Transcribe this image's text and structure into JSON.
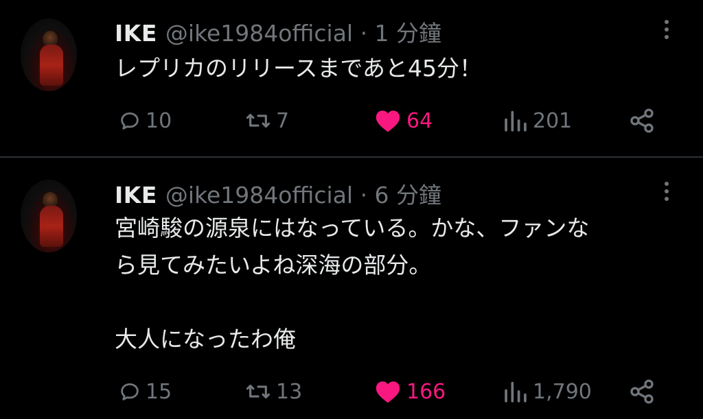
{
  "tweets": [
    {
      "name": "IKE",
      "meta": "@ike1984official · 1 分鐘",
      "text": "レプリカのリリースまであと45分！",
      "replies": "10",
      "retweets": "7",
      "likes": "64",
      "views": "201",
      "liked": true
    },
    {
      "name": "IKE",
      "meta": "@ike1984official · 6 分鐘",
      "text_lines": [
        "宮崎駿の源泉にはなっている。かな、ファンな",
        "ら見てみたいよね深海の部分。",
        "",
        "大人になったわ俺"
      ],
      "replies": "15",
      "retweets": "13",
      "likes": "166",
      "views": "1,790",
      "liked": true
    }
  ],
  "icons": {
    "reply": "reply-icon",
    "retweet": "retweet-icon",
    "like": "heart-icon",
    "views": "views-icon",
    "share": "share-icon",
    "more": "more-icon"
  },
  "colors": {
    "background": "#000000",
    "text": "#e7e9ea",
    "muted": "#71767b",
    "like": "#f91880",
    "divider": "#2f3336"
  }
}
